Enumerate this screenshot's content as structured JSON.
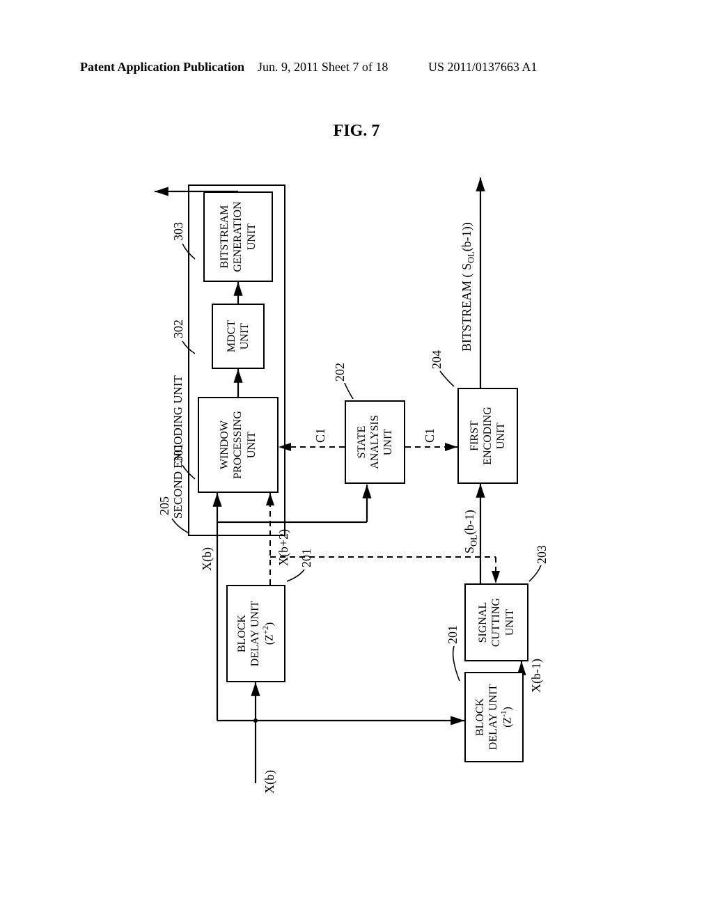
{
  "header": {
    "left": "Patent Application Publication",
    "center": "Jun. 9, 2011  Sheet 7 of 18",
    "right": "US 2011/0137663 A1"
  },
  "figure_title": "FIG. 7",
  "labels": {
    "input": "X(b)",
    "xb_top": "X(b)",
    "xb_plus2": "X(b+2)",
    "xb_minus1": "X(b-1)",
    "sol_minus1": "S",
    "sol_sub": "OL",
    "sol_paren": "(b-1)",
    "c1_top": "C1",
    "c1_bot": "C1",
    "bitstream_out": "BITSTREAM ( S",
    "bitstream_out_paren": "(b-1))"
  },
  "refnums": {
    "n205": "205",
    "n201a": "201",
    "n201b": "201",
    "n202": "202",
    "n203": "203",
    "n204": "204",
    "n301": "301",
    "n302": "302",
    "n303": "303"
  },
  "blocks": {
    "second_encoding": "SECOND ENCODING UNIT",
    "block_delay_a": "BLOCK\nDELAY UNIT\n(Z",
    "block_delay_a_exp": "+2",
    "block_delay_a_close": ")",
    "block_delay_b": "BLOCK\nDELAY UNIT\n(Z",
    "block_delay_b_exp": "-1",
    "block_delay_b_close": ")",
    "signal_cutting": "SIGNAL\nCUTTING\nUNIT",
    "state_analysis": "STATE\nANALYSIS\nUNIT",
    "first_encoding": "FIRST\nENCODING\nUNIT",
    "window_processing": "WINDOW\nPROCESSING\nUNIT",
    "mdct": "MDCT\nUNIT",
    "bitstream_gen": "BITSTREAM\nGENERATION\nUNIT"
  }
}
